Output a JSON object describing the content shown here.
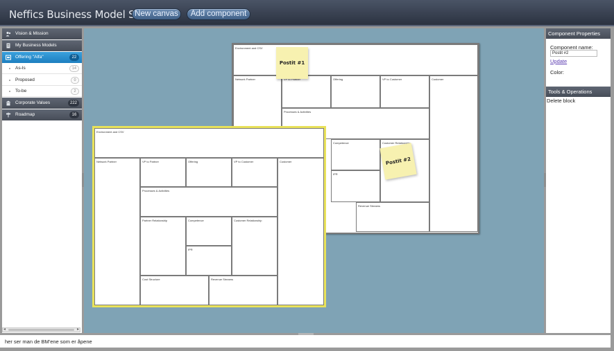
{
  "app": {
    "title": "Neffics Business Model Suite"
  },
  "toolbar": {
    "new_canvas": "New canvas",
    "add_component": "Add component"
  },
  "sidebar": {
    "items": [
      {
        "label": "Vision & Mission",
        "icon": "people-icon"
      },
      {
        "label": "My Business Models",
        "icon": "document-icon"
      },
      {
        "label": "Offering \"Alfa\"",
        "icon": "canvas-icon",
        "count": "22",
        "active": true
      },
      {
        "label": "As-Is",
        "count": "14"
      },
      {
        "label": "Proposed",
        "count": "0"
      },
      {
        "label": "To-be",
        "count": "2"
      },
      {
        "label": "Corporate Values",
        "icon": "building-icon",
        "count": "222"
      },
      {
        "label": "Roadmap",
        "icon": "signpost-icon",
        "count": "16"
      }
    ]
  },
  "canvas_back": {
    "cells": {
      "env": "Environment and CSV",
      "network": "Network Partner",
      "vp_partner": "VP to Partner",
      "offering": "Offering",
      "vp_customer": "VP to Customer",
      "customer": "Customer",
      "processes": "Processes & Activities",
      "competence": "Competence",
      "customer_rel": "Customer Relationship",
      "ipr": "IPR",
      "revenue": "Revenue Streams"
    },
    "postits": [
      "Postit #1",
      "Postit #2"
    ]
  },
  "canvas_front": {
    "cells": {
      "env": "Environment and CSV",
      "network": "Network Partner",
      "vp_partner": "VP to Partner",
      "offering": "Offering",
      "vp_customer": "VP to Customer",
      "customer": "Customer",
      "processes": "Processes & Activities",
      "partner_rel": "Partner Relationship",
      "competence": "Competence",
      "customer_rel": "Customer Relationship",
      "ipr": "IPR",
      "cost": "Cost Structure",
      "revenue": "Revenue Streams"
    }
  },
  "right_panel": {
    "component_properties": "Component Properties",
    "component_name_label": "Component name:",
    "component_name_value": "Postit #2",
    "update": "Update",
    "color_label": "Color:",
    "tools_operations": "Tools & Operations",
    "delete_block": "Delete block"
  },
  "footer": {
    "status": "her ser man de BM'ene som er åpene"
  },
  "colors": {
    "canvas_bg": "#7fa3b5",
    "active_nav": "#2a8fd0",
    "selected_border": "#e9e25a",
    "postit": "#f7f1b0"
  }
}
